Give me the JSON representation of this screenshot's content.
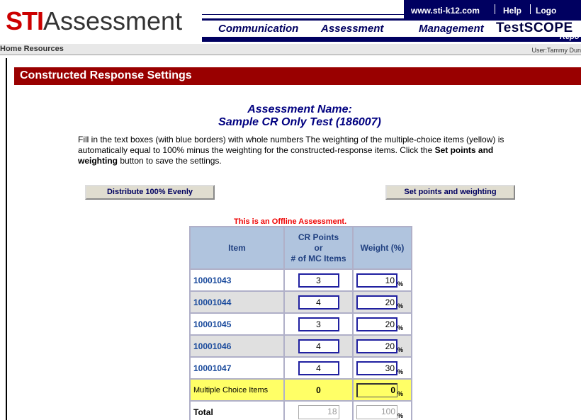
{
  "header": {
    "logo_sti": "STI",
    "logo_assessment": "Assessment",
    "top_links": {
      "site": "www.sti-k12.com",
      "help": "Help",
      "logout": "Logo"
    },
    "nav": {
      "communication": "Communication",
      "assessment": "Assessment",
      "management": "Management",
      "testscope": "TestSCOPE",
      "reports": "Repo"
    }
  },
  "subnav": {
    "links": "Home Resources",
    "user": "User:Tammy Dun"
  },
  "page": {
    "title": "Constructed Response Settings",
    "assessment_label": "Assessment Name:",
    "assessment_name": "Sample CR Only Test (186007)",
    "instructions_1": "Fill in the text boxes (with blue borders) with whole numbers The weighting of the multiple-choice items (yellow) is automatically equal to 100% minus the weighting for the constructed-response items. Click the ",
    "instructions_bold": "Set points and weighting",
    "instructions_2": " button to save the settings.",
    "distribute_button": "Distribute 100% Evenly",
    "set_button": "Set points and weighting",
    "offline_notice": "This is an Offline Assessment."
  },
  "table": {
    "headers": {
      "item": "Item",
      "cr_points_1": "CR Points",
      "cr_points_2": "or",
      "cr_points_3": "# of MC Items",
      "weight": "Weight (%)"
    },
    "rows": [
      {
        "item": "10001043",
        "points": "3",
        "weight": "10"
      },
      {
        "item": "10001044",
        "points": "4",
        "weight": "20"
      },
      {
        "item": "10001045",
        "points": "3",
        "weight": "20"
      },
      {
        "item": "10001046",
        "points": "4",
        "weight": "20"
      },
      {
        "item": "10001047",
        "points": "4",
        "weight": "30"
      }
    ],
    "mc": {
      "label": "Multiple Choice Items",
      "points": "0",
      "weight": "0"
    },
    "total": {
      "label": "Total",
      "points": "18",
      "weight": "100"
    },
    "pct_symbol": "%"
  }
}
